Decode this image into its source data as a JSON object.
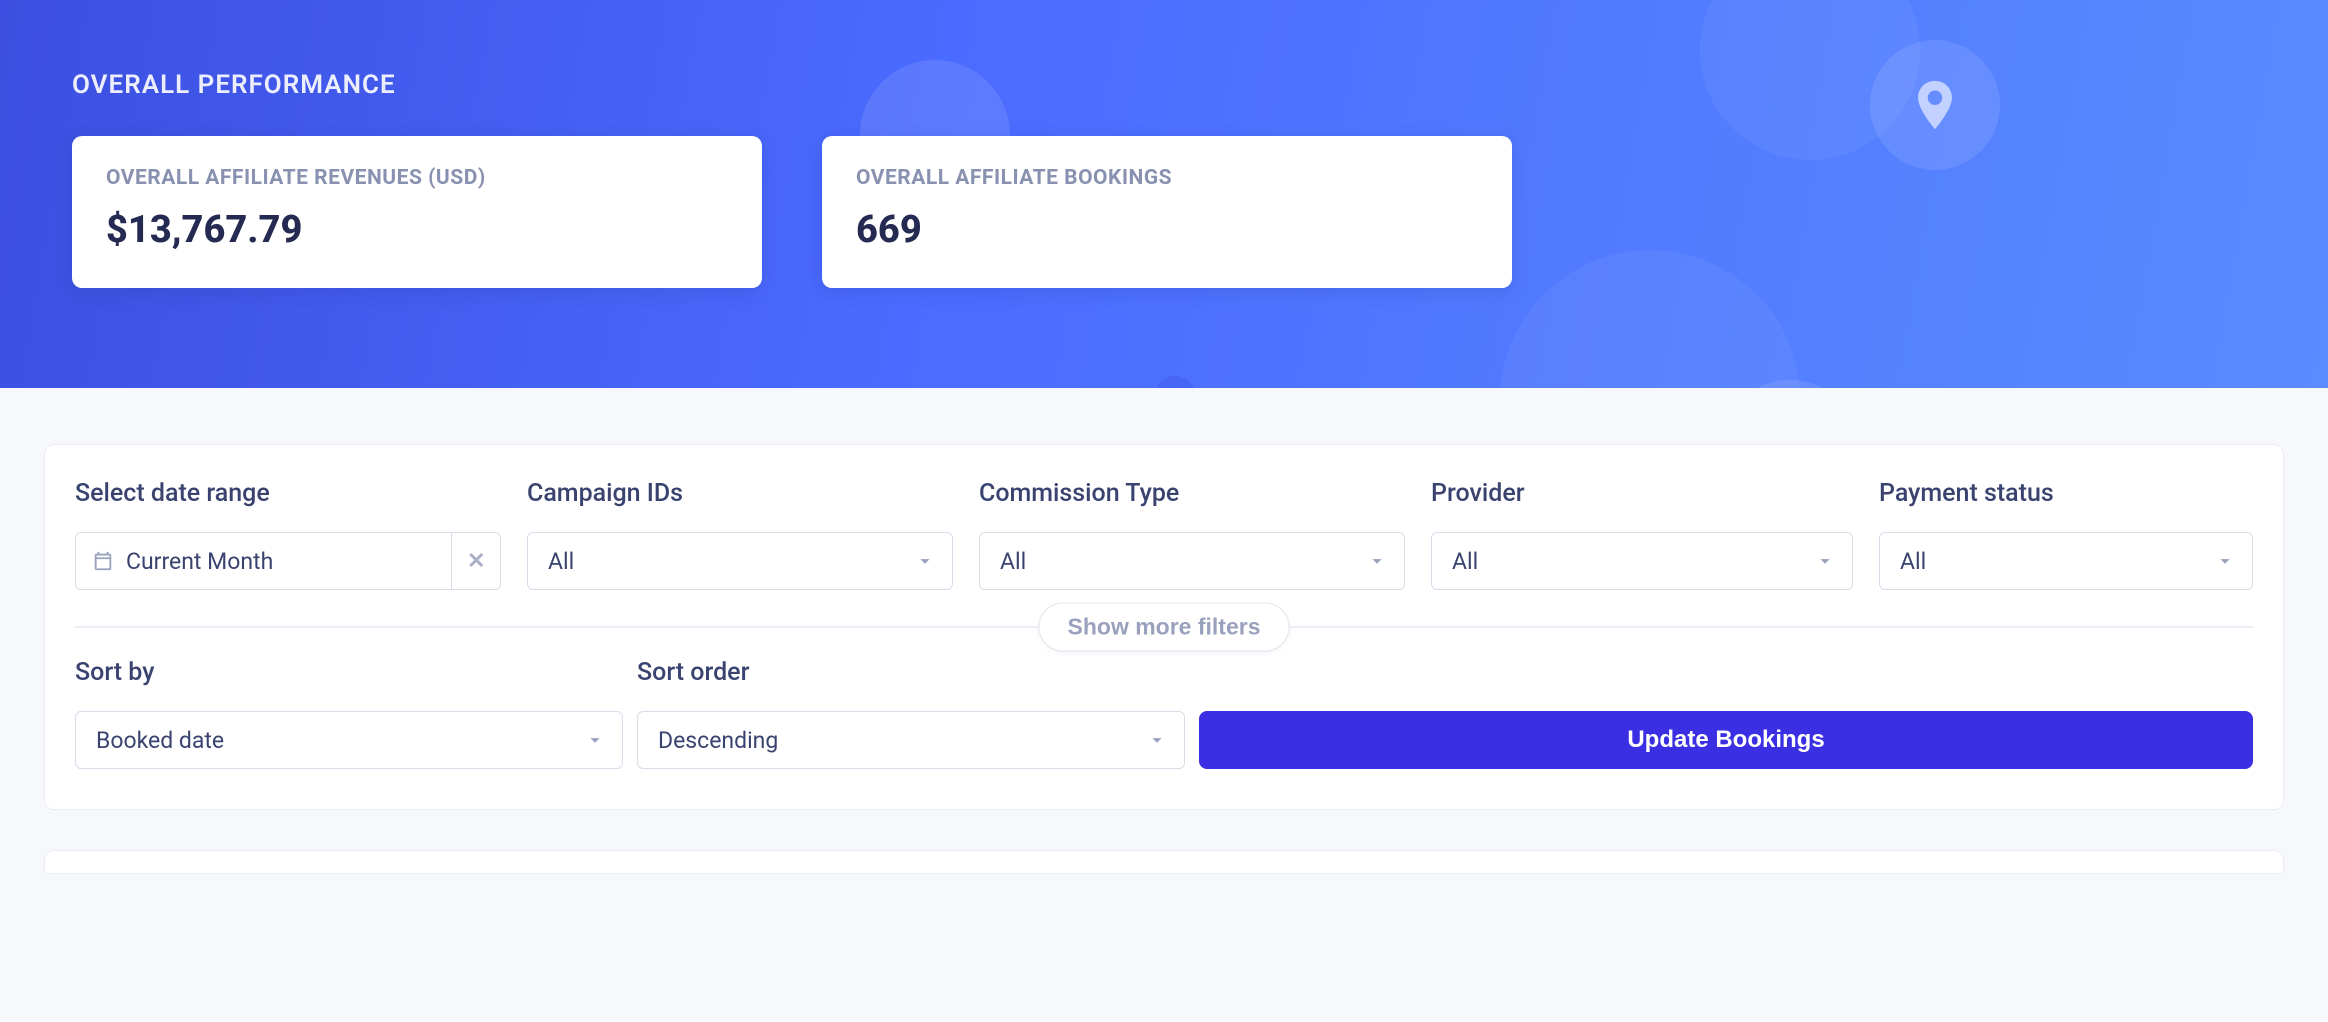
{
  "header": {
    "title": "OVERALL PERFORMANCE"
  },
  "stats": {
    "revenue": {
      "label": "OVERALL AFFILIATE REVENUES (USD)",
      "value": "$13,767.79"
    },
    "bookings": {
      "label": "OVERALL AFFILIATE BOOKINGS",
      "value": "669"
    }
  },
  "filters": {
    "date_range": {
      "label": "Select date range",
      "value": "Current Month"
    },
    "campaign_ids": {
      "label": "Campaign IDs",
      "value": "All"
    },
    "commission": {
      "label": "Commission Type",
      "value": "All"
    },
    "provider": {
      "label": "Provider",
      "value": "All"
    },
    "payment": {
      "label": "Payment status",
      "value": "All"
    },
    "show_more_label": "Show more filters"
  },
  "sort": {
    "by": {
      "label": "Sort by",
      "value": "Booked date"
    },
    "order": {
      "label": "Sort order",
      "value": "Descending"
    },
    "update_label": "Update Bookings"
  }
}
